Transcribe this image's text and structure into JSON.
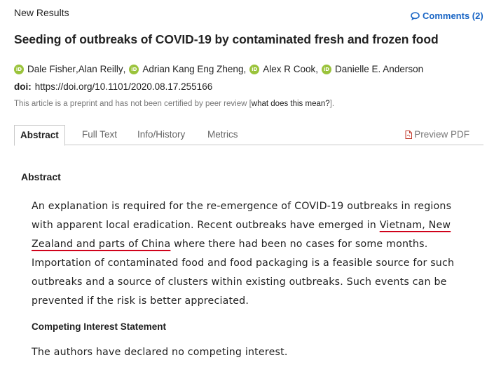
{
  "header": {
    "section_label": "New Results",
    "comments_label": "Comments (2)"
  },
  "article": {
    "title": "Seeding of outbreaks of COVID-19 by contaminated fresh and frozen food",
    "orcid_icon_text": "iD",
    "authors": [
      "Dale Fisher",
      "Alan Reilly",
      "Adrian Kang Eng Zheng",
      "Alex R Cook",
      "Danielle E. Anderson"
    ],
    "doi_label": "doi:",
    "doi_url": "https://doi.org/10.1101/2020.08.17.255166",
    "preprint_note_prefix": "This article is a preprint and has not been certified by peer review [",
    "preprint_note_link": "what does this mean?",
    "preprint_note_suffix": "]."
  },
  "tabs": [
    {
      "label": "Abstract",
      "active": true
    },
    {
      "label": "Full Text",
      "active": false
    },
    {
      "label": "Info/History",
      "active": false
    },
    {
      "label": "Metrics",
      "active": false
    }
  ],
  "preview_pdf_label": "Preview PDF",
  "abstract": {
    "heading": "Abstract",
    "line1": "An explanation is required for the re-emergence of COVID-19 outbreaks in regions",
    "line2_pre": "with apparent local eradication. Recent outbreaks have emerged in ",
    "line2_highlight": "Vietnam, New",
    "line3_highlight": "Zealand and parts of China",
    "line3_post": " where there had been no cases for some months.",
    "line4": "Importation of contaminated food and food packaging is a feasible source for such",
    "line5": "outbreaks and a source of clusters within existing outbreaks. Such events can be",
    "line6": "prevented if the risk is better appreciated.",
    "underline_color": "#d0021b"
  },
  "competing_interest": {
    "heading": "Competing Interest Statement",
    "text": "The authors have declared no competing interest."
  },
  "colors": {
    "link_blue": "#1a66c5",
    "orcid_green": "#9ac33b",
    "pdf_red": "#c0392b"
  }
}
